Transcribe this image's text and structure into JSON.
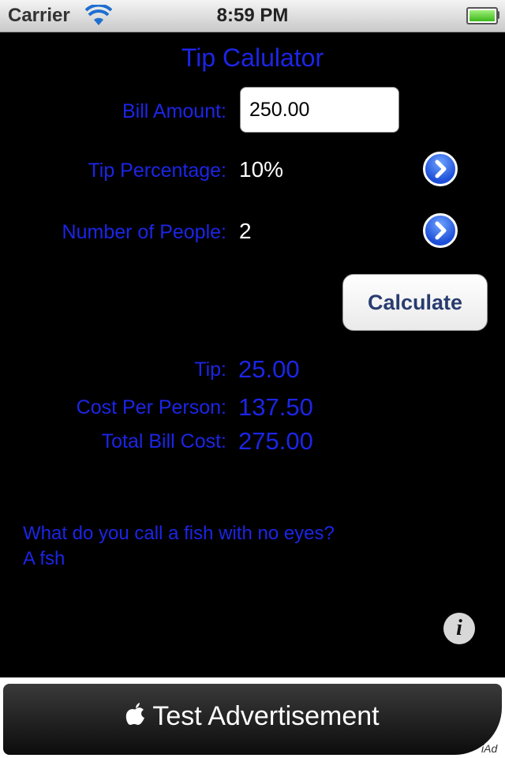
{
  "status_bar": {
    "carrier": "Carrier",
    "time": "8:59 PM",
    "wifi_icon": "wifi-icon",
    "battery_icon": "battery-icon"
  },
  "app": {
    "title": "Tip Calulator"
  },
  "form": {
    "bill_label": "Bill Amount:",
    "bill_value": "250.00",
    "tip_label": "Tip Percentage:",
    "tip_value": "10%",
    "people_label": "Number of People:",
    "people_value": "2",
    "calculate_label": "Calculate"
  },
  "results": {
    "tip_label": "Tip:",
    "tip_value": "25.00",
    "per_person_label": "Cost Per Person:",
    "per_person_value": "137.50",
    "total_label": "Total Bill Cost:",
    "total_value": "275.00"
  },
  "joke": {
    "line1": "What do you call a fish with no eyes?",
    "line2": "A fsh"
  },
  "ad": {
    "text": "Test Advertisement",
    "badge": "iAd"
  },
  "colors": {
    "accent_blue": "#1c25e6",
    "background": "#000000"
  }
}
